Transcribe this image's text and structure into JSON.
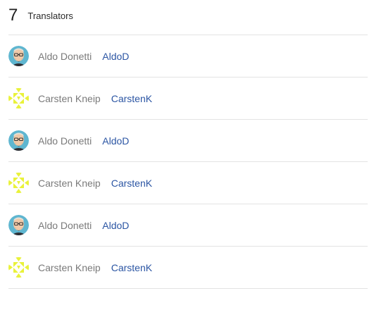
{
  "header": {
    "count": "7",
    "title": "Translators"
  },
  "translators": [
    {
      "name": "Aldo Donetti",
      "handle": "AldoD",
      "avatar": "aldo-avatar"
    },
    {
      "name": "Carsten Kneip",
      "handle": "CarstenK",
      "avatar": "identicon-avatar"
    },
    {
      "name": "Aldo Donetti",
      "handle": "AldoD",
      "avatar": "aldo-avatar"
    },
    {
      "name": "Carsten Kneip",
      "handle": "CarstenK",
      "avatar": "identicon-avatar"
    },
    {
      "name": "Aldo Donetti",
      "handle": "AldoD",
      "avatar": "aldo-avatar"
    },
    {
      "name": "Carsten Kneip",
      "handle": "CarstenK",
      "avatar": "identicon-avatar"
    }
  ],
  "colors": {
    "link": "#2b55a3",
    "name": "#7a7a7a",
    "aldo_avatar_bg": "#5fb6d0",
    "identicon_fg": "#e9f23a"
  }
}
